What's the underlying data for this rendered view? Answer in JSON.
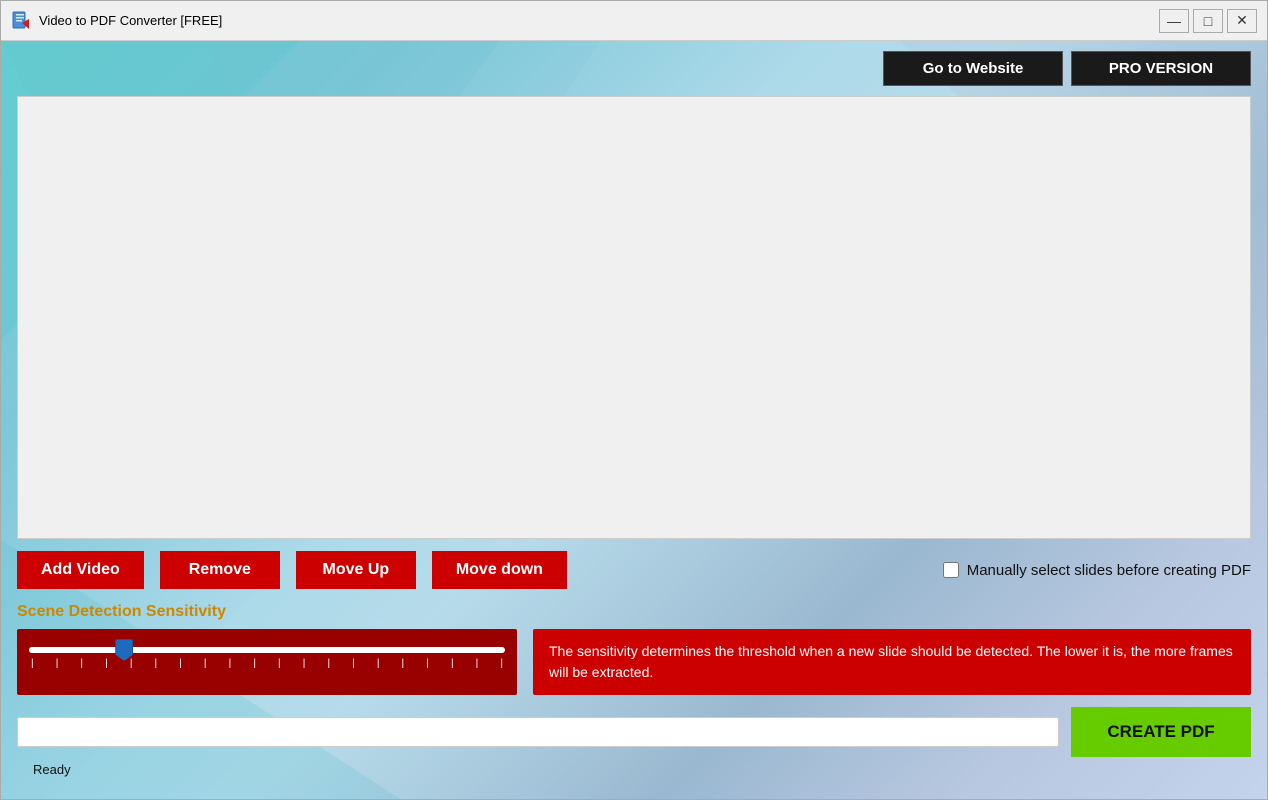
{
  "window": {
    "title": "Video to PDF Converter [FREE]",
    "icon": "📄"
  },
  "titlebar": {
    "minimize_label": "—",
    "maximize_label": "□",
    "close_label": "✕"
  },
  "header": {
    "go_to_website_label": "Go to Website",
    "pro_version_label": "PRO VERSION"
  },
  "action_buttons": {
    "add_video_label": "Add Video",
    "remove_label": "Remove",
    "move_up_label": "Move Up",
    "move_down_label": "Move down"
  },
  "checkbox": {
    "label": "Manually select slides before creating PDF",
    "checked": false
  },
  "scene_detection": {
    "title": "Scene Detection Sensitivity",
    "slider_value": 20,
    "info_text": "The sensitivity determines the threshold when a new slide should be detected. The lower it is, the more frames will be extracted."
  },
  "bottom": {
    "create_pdf_label": "CREATE PDF",
    "status_text": "Ready",
    "progress_value": 0
  }
}
